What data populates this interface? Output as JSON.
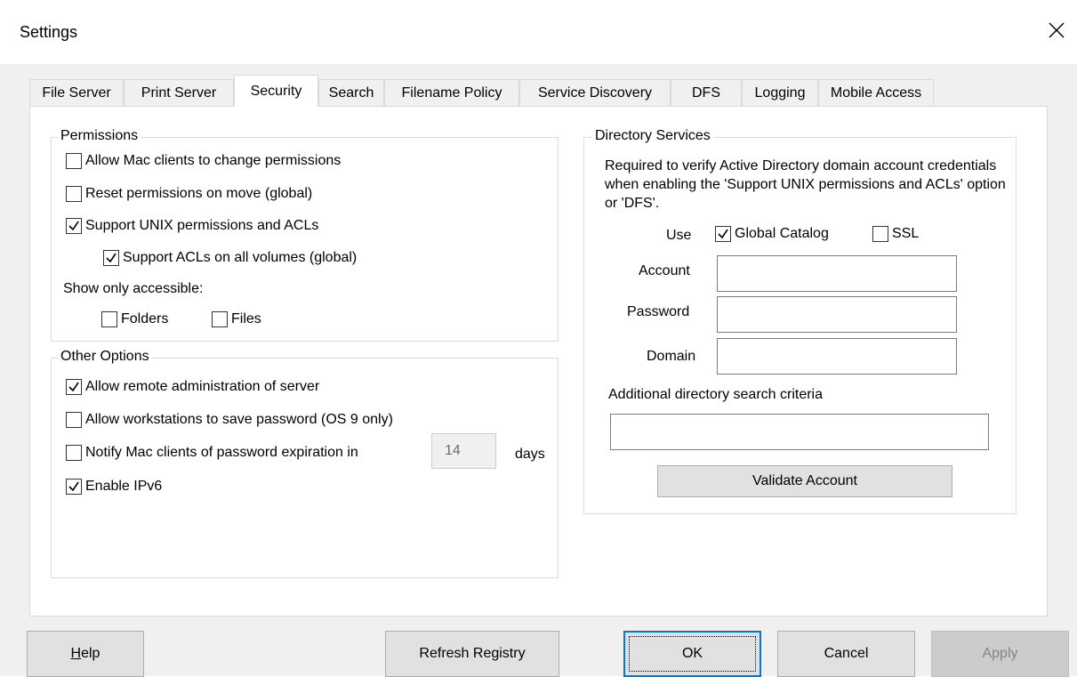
{
  "window": {
    "title": "Settings"
  },
  "tabs": [
    {
      "label": "File Server",
      "active": false
    },
    {
      "label": "Print Server",
      "active": false
    },
    {
      "label": "Security",
      "active": true
    },
    {
      "label": "Search",
      "active": false
    },
    {
      "label": "Filename Policy",
      "active": false
    },
    {
      "label": "Service Discovery",
      "active": false
    },
    {
      "label": "DFS",
      "active": false
    },
    {
      "label": "Logging",
      "active": false
    },
    {
      "label": "Mobile Access",
      "active": false
    }
  ],
  "permissions": {
    "title": "Permissions",
    "items": [
      {
        "label": "Allow Mac clients to change permissions",
        "checked": false
      },
      {
        "label": "Reset permissions on move (global)",
        "checked": false
      },
      {
        "label": "Support UNIX permissions and ACLs",
        "checked": true
      },
      {
        "label": "Support ACLs on all volumes (global)",
        "checked": true
      }
    ],
    "show_only_label": "Show only accessible:",
    "folders": {
      "label": "Folders",
      "checked": false
    },
    "files": {
      "label": "Files",
      "checked": false
    }
  },
  "other_options": {
    "title": "Other Options",
    "remote_admin": {
      "label": "Allow remote administration of server",
      "checked": true
    },
    "save_password": {
      "label": "Allow workstations to save password (OS 9 only)",
      "checked": false
    },
    "notify_expiration": {
      "label": "Notify Mac clients of password expiration in",
      "checked": false
    },
    "days_value": "14",
    "days_label": "days",
    "ipv6": {
      "label": "Enable IPv6",
      "checked": true
    }
  },
  "directory_services": {
    "title": "Directory Services",
    "description": "Required to verify Active Directory domain account credentials when enabling the 'Support UNIX permissions and ACLs' option or 'DFS'.",
    "use_label": "Use",
    "global_catalog": {
      "label": "Global Catalog",
      "checked": true
    },
    "ssl": {
      "label": "SSL",
      "checked": false
    },
    "account_label": "Account",
    "account_value": "",
    "password_label": "Password",
    "password_value": "",
    "domain_label": "Domain",
    "domain_value": "",
    "search_criteria_label": "Additional directory search criteria",
    "search_criteria_value": "",
    "validate_button": "Validate Account"
  },
  "buttons": {
    "help_prefix": "",
    "help_accel": "H",
    "help_rest": "elp",
    "refresh": "Refresh Registry",
    "ok": "OK",
    "cancel": "Cancel",
    "apply": "Apply"
  },
  "colors": {
    "focus_accent": "#0078d7",
    "dialog_bg": "#f0f0f0"
  }
}
